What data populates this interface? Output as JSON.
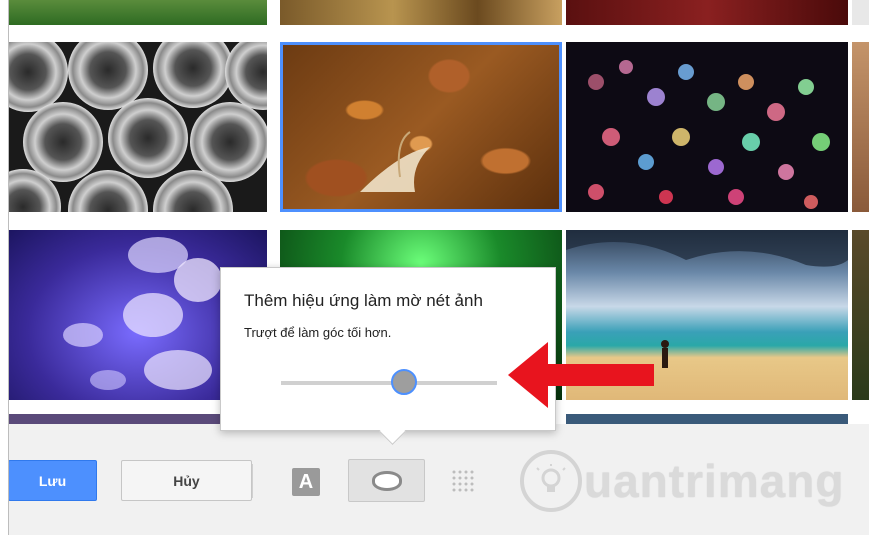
{
  "dialog": {
    "title": "Thêm hiệu ứng làm mờ nét ảnh",
    "subtitle": "Trượt để làm góc tối hơn.",
    "slider_value": 0.57
  },
  "toolbar": {
    "save_label": "Lưu",
    "cancel_label": "Hủy",
    "text_tool_label": "A",
    "accent_color": "#4d90fe"
  },
  "watermark": {
    "text": "uantrimang"
  },
  "icons": [
    "text-style-icon",
    "vignette-icon",
    "blur-grid-icon",
    "pointer-arrow-icon",
    "watermark-logo-icon"
  ]
}
